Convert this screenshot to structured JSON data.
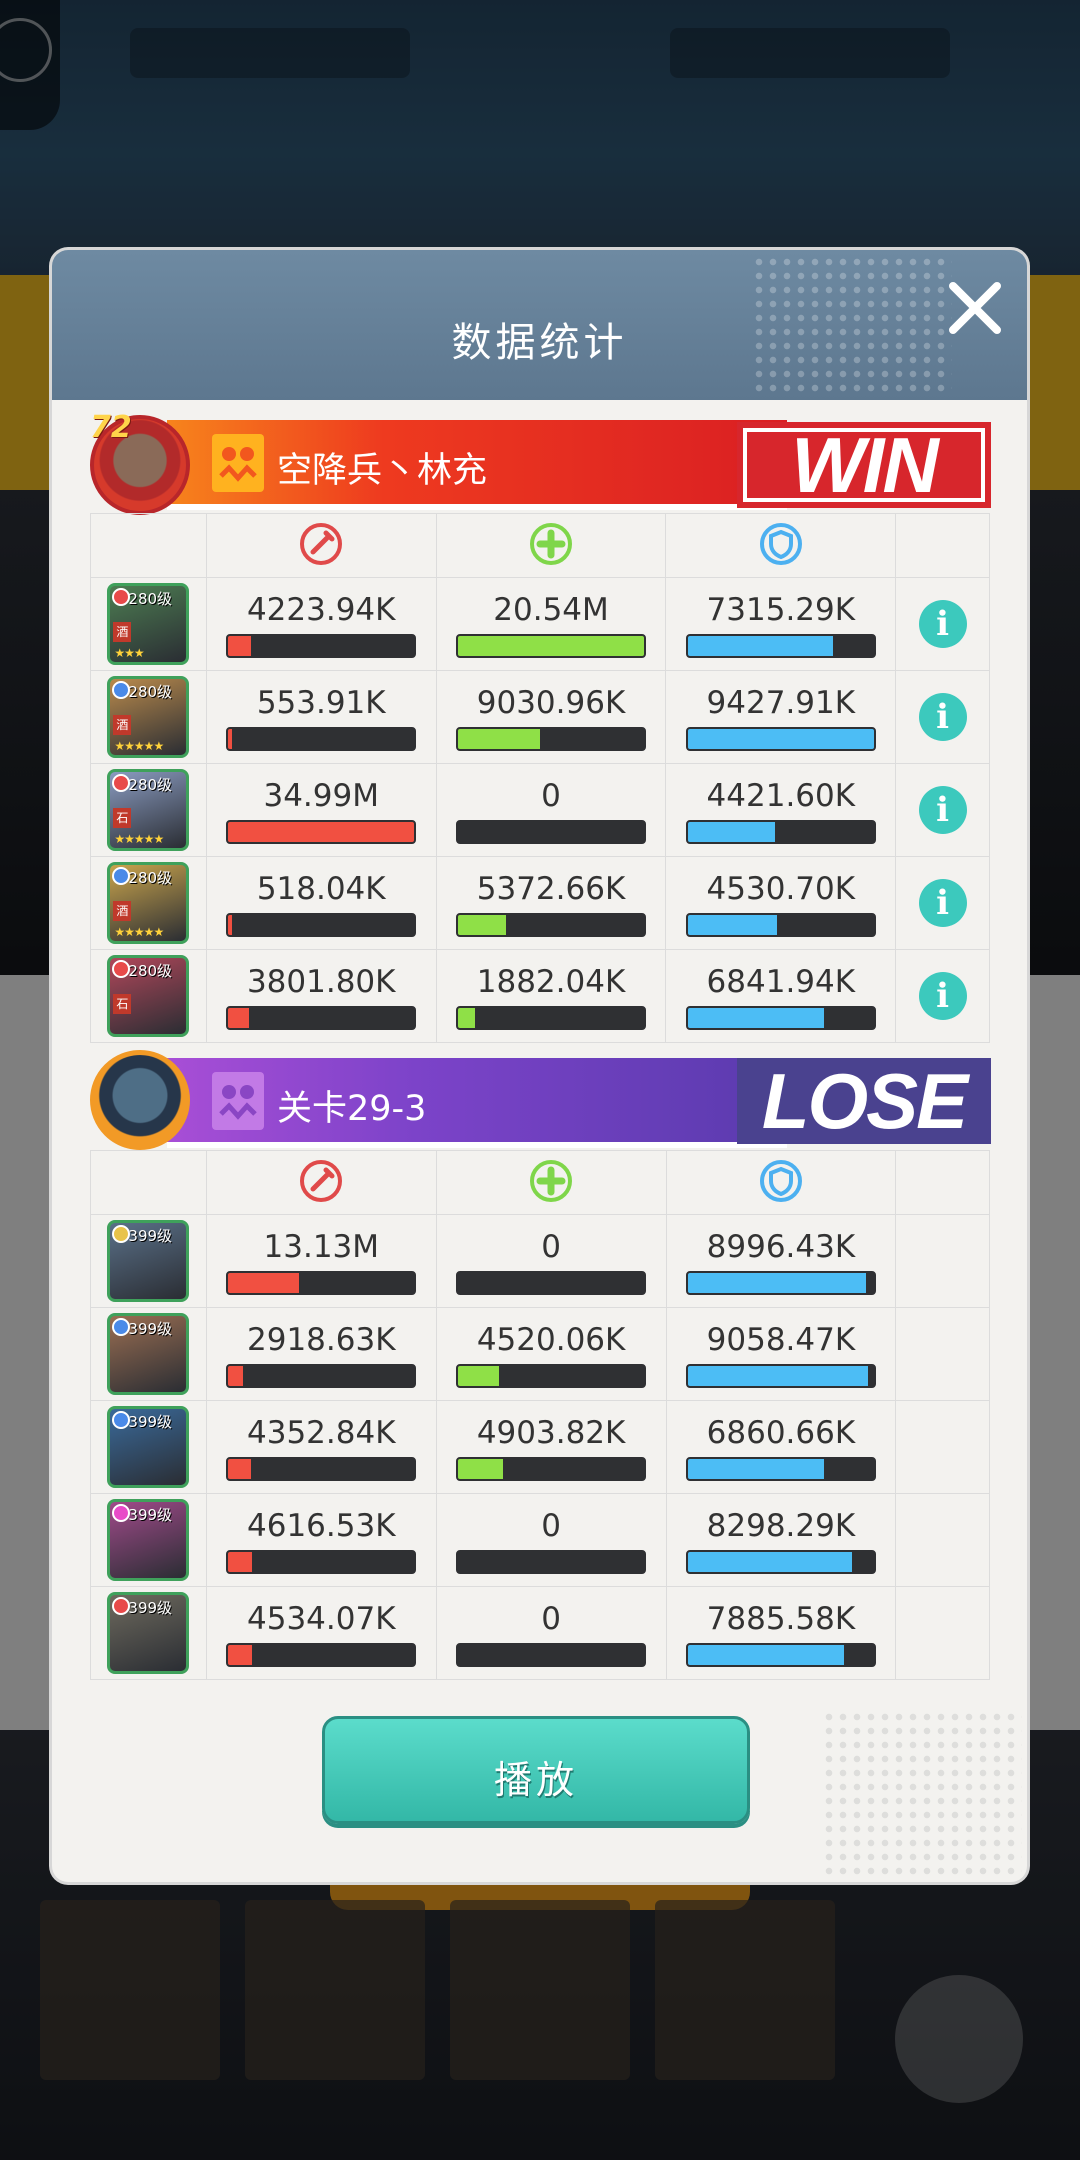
{
  "dialog": {
    "title": "数据统计",
    "close_icon": "close-icon",
    "play_label": "播放"
  },
  "columns": {
    "damage_icon": "sword-icon",
    "heal_icon": "plus-cross-icon",
    "defense_icon": "shield-icon",
    "colors": {
      "damage": "#f15041",
      "heal": "#8fe047",
      "defense": "#4cbdf5"
    }
  },
  "team_win": {
    "level": "72",
    "name": "空降兵丶林充",
    "result": "WIN",
    "heroes": [
      {
        "level": "280级",
        "element_color": "#e84a4a",
        "tag": "酒",
        "stars": "★★★",
        "damage": "4223.94K",
        "damage_frac": 0.12,
        "heal": "20.54M",
        "heal_frac": 1.0,
        "defense": "7315.29K",
        "defense_frac": 0.78,
        "portrait": "#4d7d52"
      },
      {
        "level": "280级",
        "element_color": "#4a8ae8",
        "tag": "酒",
        "stars": "★★★★★",
        "damage": "553.91K",
        "damage_frac": 0.02,
        "heal": "9030.96K",
        "heal_frac": 0.44,
        "defense": "9427.91K",
        "defense_frac": 1.0,
        "portrait": "#b98a4c"
      },
      {
        "level": "280级",
        "element_color": "#e84a4a",
        "tag": "石",
        "stars": "★★★★★",
        "damage": "34.99M",
        "damage_frac": 1.0,
        "heal": "0",
        "heal_frac": 0,
        "defense": "4421.60K",
        "defense_frac": 0.47,
        "portrait": "#8a9bc0"
      },
      {
        "level": "280级",
        "element_color": "#4a8ae8",
        "tag": "酒",
        "stars": "★★★★★",
        "damage": "518.04K",
        "damage_frac": 0.02,
        "heal": "5372.66K",
        "heal_frac": 0.26,
        "defense": "4530.70K",
        "defense_frac": 0.48,
        "portrait": "#c9a44c"
      },
      {
        "level": "280级",
        "element_color": "#e84a4a",
        "tag": "石",
        "stars": "",
        "damage": "3801.80K",
        "damage_frac": 0.11,
        "heal": "1882.04K",
        "heal_frac": 0.09,
        "defense": "6841.94K",
        "defense_frac": 0.73,
        "portrait": "#b0475a"
      }
    ]
  },
  "team_lose": {
    "name": "关卡29-3",
    "result": "LOSE",
    "heroes": [
      {
        "level": "399级",
        "element_color": "#e8c34a",
        "damage": "13.13M",
        "damage_frac": 0.38,
        "heal": "0",
        "heal_frac": 0,
        "defense": "8996.43K",
        "defense_frac": 0.96,
        "portrait": "#5a7088"
      },
      {
        "level": "399级",
        "element_color": "#4a8ae8",
        "damage": "2918.63K",
        "damage_frac": 0.08,
        "heal": "4520.06K",
        "heal_frac": 0.22,
        "defense": "9058.47K",
        "defense_frac": 0.97,
        "portrait": "#9a6e52"
      },
      {
        "level": "399级",
        "element_color": "#4a8ae8",
        "damage": "4352.84K",
        "damage_frac": 0.12,
        "heal": "4903.82K",
        "heal_frac": 0.24,
        "defense": "6860.66K",
        "defense_frac": 0.73,
        "portrait": "#3a6a9a"
      },
      {
        "level": "399级",
        "element_color": "#e84ac8",
        "damage": "4616.53K",
        "damage_frac": 0.13,
        "heal": "0",
        "heal_frac": 0,
        "defense": "8298.29K",
        "defense_frac": 0.88,
        "portrait": "#a04a8a"
      },
      {
        "level": "399级",
        "element_color": "#e84a4a",
        "damage": "4534.07K",
        "damage_frac": 0.13,
        "heal": "0",
        "heal_frac": 0,
        "defense": "7885.58K",
        "defense_frac": 0.84,
        "portrait": "#6e6a5e"
      }
    ]
  }
}
